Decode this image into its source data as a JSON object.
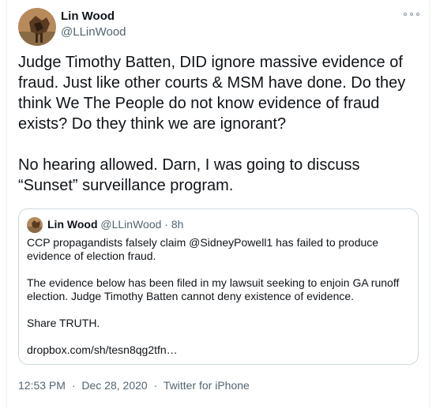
{
  "author": {
    "name": "Lin Wood",
    "handle": "@LLinWood"
  },
  "tweet_text": "Judge Timothy Batten, DID ignore massive evidence of fraud. Just like other courts & MSM have done. Do they think We The People do not know evidence of fraud exists? Do they think we are ignorant?\n\nNo hearing allowed. Darn, I was going to discuss “Sunset” surveillance program.",
  "quoted_tweet": {
    "name": "Lin Wood",
    "handle": "@LLinWood",
    "separator": "·",
    "age": "8h",
    "text": "CCP propagandists falsely claim @SidneyPowell1 has failed to produce evidence of election fraud.\n\nThe evidence below has been filed in my lawsuit seeking to enjoin GA runoff election. Judge Timothy Batten cannot deny existence of evidence.\n\nShare TRUTH.\n\ndropbox.com/sh/tesn8qg2tfn…"
  },
  "footer": {
    "time": "12:53 PM",
    "date": "Dec 28, 2020",
    "source": "Twitter for iPhone",
    "separator": "·"
  },
  "icons": {
    "more": "more-horizontal-icon"
  }
}
